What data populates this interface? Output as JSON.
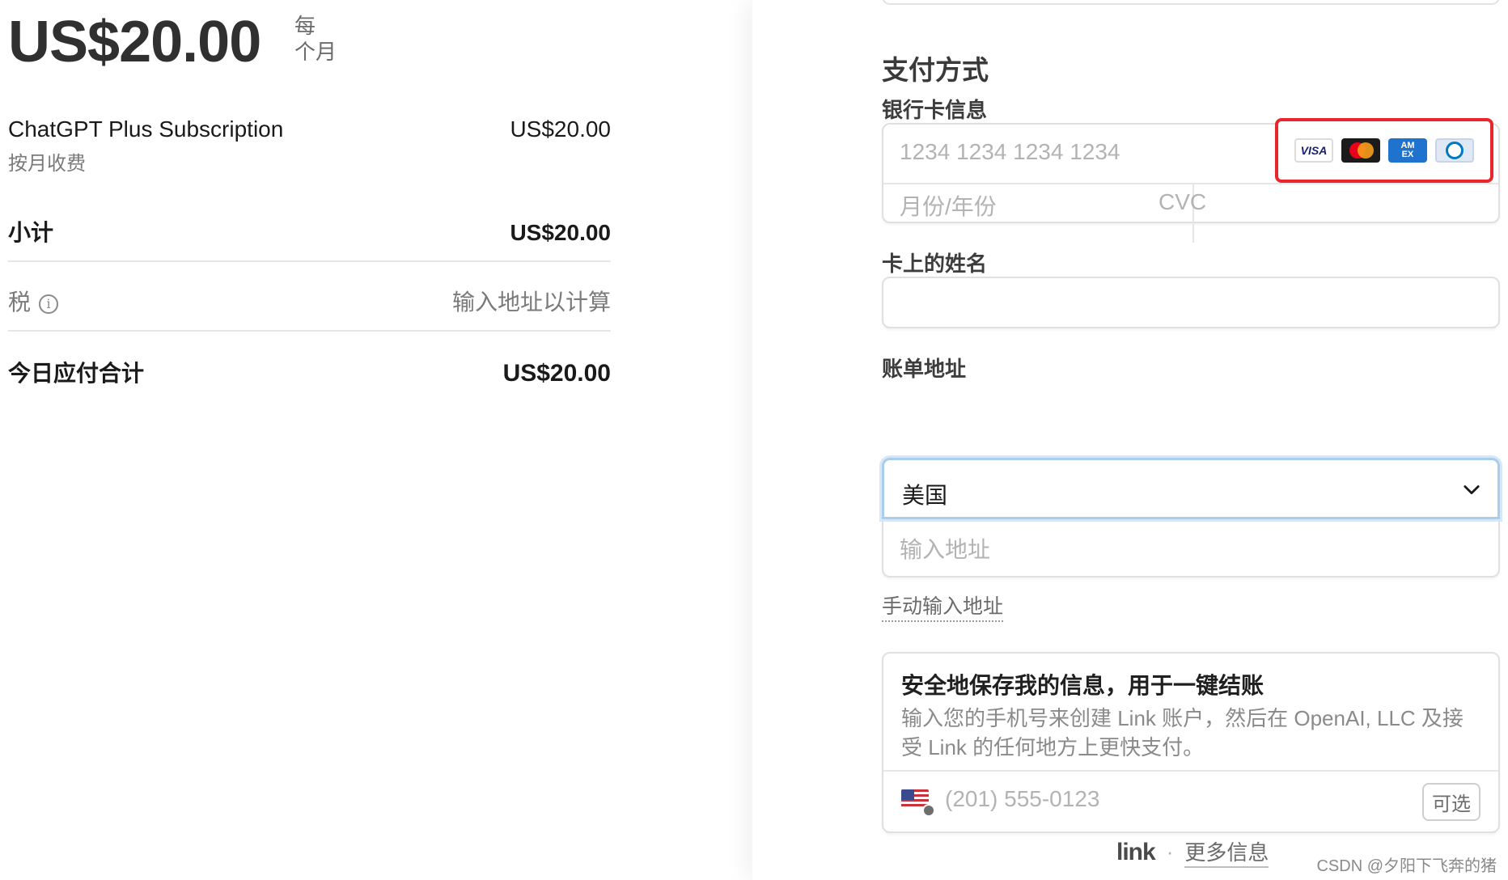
{
  "summary": {
    "price": "US$20.00",
    "per_line1": "每",
    "per_line2": "个月",
    "item_name": "ChatGPT Plus Subscription",
    "item_price": "US$20.00",
    "item_sub": "按月收费",
    "subtotal_label": "小计",
    "subtotal_value": "US$20.00",
    "tax_label": "税",
    "tax_info_icon": "info-circle-icon",
    "tax_value": "输入地址以计算",
    "total_label": "今日应付合计",
    "total_value": "US$20.00"
  },
  "form": {
    "title": "支付方式",
    "card_label": "银行卡信息",
    "card_number_placeholder": "1234 1234 1234 1234",
    "expiry_placeholder": "月份/年份",
    "cvc_placeholder": "CVC",
    "card_brands": [
      "VISA",
      "Mastercard",
      "AMEX",
      "Diners"
    ],
    "highlight_color": "#e8272c",
    "name_label": "卡上的姓名",
    "address_label": "账单地址",
    "country_value": "美国",
    "address_placeholder": "输入地址",
    "manual_address": "手动输入地址"
  },
  "link": {
    "title": "安全地保存我的信息，用于一键结账",
    "desc": "输入您的手机号来创建 Link 账户，然后在 OpenAI, LLC 及接受 Link 的任何地方上更快支付。",
    "phone_placeholder": "(201) 555-0123",
    "optional": "可选",
    "logo": "link",
    "more_info": "更多信息"
  },
  "watermark": "CSDN @夕阳下飞奔的猪"
}
